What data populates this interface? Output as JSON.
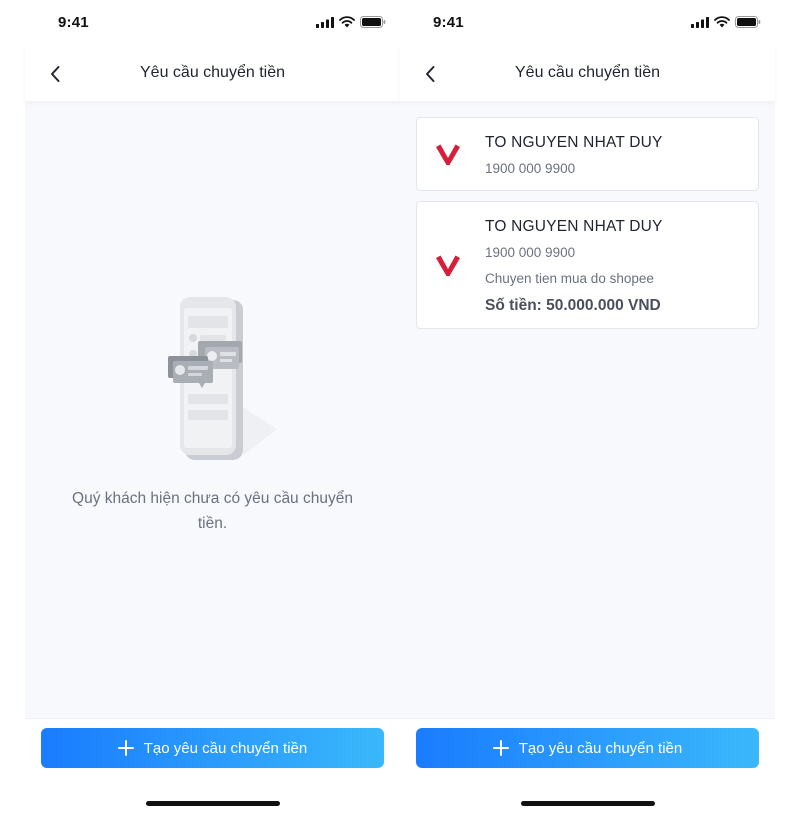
{
  "status_bar": {
    "time": "9:41"
  },
  "nav": {
    "title": "Yêu cầu chuyển tiền"
  },
  "empty_state": {
    "message": "Quý khách hiện chưa có yêu cầu chuyển tiền."
  },
  "requests": [
    {
      "name": "TO NGUYEN NHAT DUY",
      "phone": "1900 000 9900"
    },
    {
      "name": "TO NGUYEN NHAT DUY",
      "phone": "1900 000 9900",
      "description": "Chuyen tien mua do shopee",
      "amount": "Số tiền: 50.000.000 VND"
    }
  ],
  "action": {
    "create_label": "Tạo yêu cầu chuyển tiền"
  },
  "colors": {
    "primary_gradient_start": "#1a7cff",
    "primary_gradient_end": "#3ab8fb",
    "brand_logo": "#d71e3a",
    "content_background": "#f8f9fd"
  },
  "icons": {
    "back": "chevron-left-icon",
    "signal": "cellular-signal-icon",
    "wifi": "wifi-icon",
    "battery": "battery-icon",
    "add": "plus-icon",
    "brand": "bank-logo-icon",
    "empty": "phone-chat-illustration"
  }
}
